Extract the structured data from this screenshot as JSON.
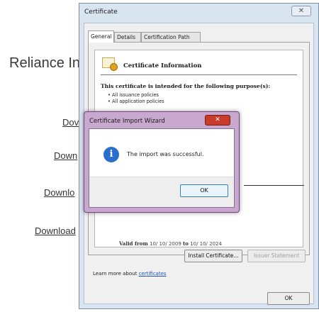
{
  "background_page": {
    "heading": "Reliance In",
    "links": [
      "Dov",
      "Down",
      "Downlo",
      "Download"
    ]
  },
  "certificate_window": {
    "title": "Certificate",
    "close_glyph": "✕",
    "tabs": [
      "General",
      "Details",
      "Certification Path"
    ],
    "active_tab": "General",
    "info_heading": "Certificate Information",
    "purpose_heading": "This certificate is intended for the following purpose(s):",
    "purposes": [
      "• All issuance policies",
      "• All application policies"
    ],
    "valid_row": {
      "label": "Valid from",
      "from_partial": "10/ 10/ 2009",
      "to_label": "to",
      "to_partial": "10/ 10/ 2024"
    },
    "install_button": "Install Certificate...",
    "issuer_button": "Issuer Statement",
    "learn_prefix": "Learn more about ",
    "learn_link": "certificates",
    "ok_button": "OK"
  },
  "import_wizard": {
    "title": "Certificate Import Wizard",
    "close_glyph": "✕",
    "icon": "info-icon",
    "message": "The import was successful.",
    "ok_button": "OK"
  },
  "colors": {
    "window_frame": "#d9e4f1",
    "dialog_frame": "#c9a8cf",
    "close_red": "#c83a2a",
    "info_blue": "#2a6fd0",
    "link_blue": "#1a55c0"
  }
}
